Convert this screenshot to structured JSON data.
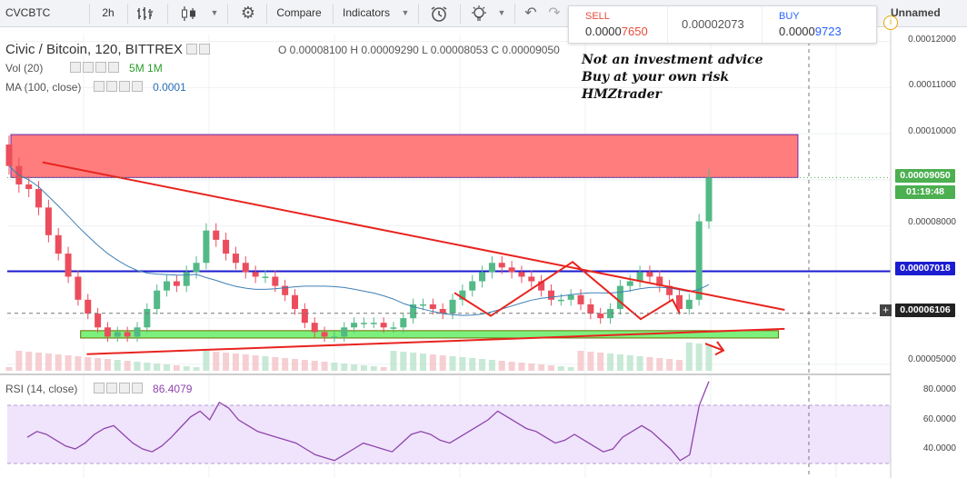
{
  "toolbar": {
    "symbol": "CVCBTC",
    "interval": "2h",
    "compare_label": "Compare",
    "indicators_label": "Indicators",
    "layout_name": "Unnamed"
  },
  "quote": {
    "sell_label": "SELL",
    "sell_price_main": "0.0000",
    "sell_price_tail": "7650",
    "spread": "0.00002073",
    "buy_label": "BUY",
    "buy_price_main": "0.0000",
    "buy_price_tail": "9723"
  },
  "legend": {
    "title": "Civic / Bitcoin, 120, BITTREX",
    "ohlc": "O 0.00008100  H 0.00009290  L 0.00008053  C 0.00009050",
    "vol_label": "Vol (20)",
    "vol_intervals": "5M  1M",
    "ma_label": "MA (100, close)",
    "ma_value": "0.0001",
    "rsi_label": "RSI (14, close)",
    "rsi_value": "86.4079"
  },
  "annotation": {
    "line1": "Not an investment advice",
    "line2": "Buy at your own risk",
    "line3": "HMZtrader"
  },
  "price_axis": {
    "ticks": [
      "0.00012000",
      "0.00011000",
      "0.00010000",
      "0.00008000",
      "0.00005000"
    ],
    "current_price": "0.00009050",
    "countdown": "01:19:48",
    "support_price": "0.00007018",
    "crosshair_price": "0.00006106"
  },
  "rsi_axis": {
    "ticks": [
      "80.0000",
      "60.0000",
      "40.0000"
    ]
  },
  "colors": {
    "up": "#53b987",
    "down": "#eb4d5c",
    "resistance_zone": "#ff7d7d",
    "support_zone": "#7cf07c",
    "trend_lines": "#e8241f",
    "support_line": "#1c1cd1",
    "ma_line": "#3e7fb5",
    "rsi_line": "#8e44ad",
    "rsi_band": "#efe4fb"
  },
  "chart_data": {
    "type": "candlestick",
    "ylim": [
      4.86e-05,
      0.0001215
    ],
    "grid": true,
    "horizontal_levels": {
      "resistance_zone": [
        9.05e-05,
        9.98e-05
      ],
      "support_zone": [
        5.57e-05,
        5.73e-05
      ],
      "support_line": 7.018e-05
    },
    "trend_lines": [
      {
        "name": "",
        "from": [
          0.04,
          9.38e-05
        ],
        "to": [
          0.88,
          6.18e-05
        ]
      },
      {
        "name": "",
        "from": [
          0.09,
          5.22e-05
        ],
        "to": [
          0.88,
          5.77e-05
        ]
      }
    ],
    "closes": [
      9.3e-05,
      8.9e-05,
      8.8e-05,
      8.4e-05,
      7.8e-05,
      7.4e-05,
      6.9e-05,
      6.4e-05,
      6.1e-05,
      5.8e-05,
      5.6e-05,
      5.7e-05,
      5.6e-05,
      5.8e-05,
      6.2e-05,
      6.6e-05,
      6.8e-05,
      6.7e-05,
      7e-05,
      7.2e-05,
      7.9e-05,
      7.7e-05,
      7.4e-05,
      7.2e-05,
      7e-05,
      6.9e-05,
      6.9e-05,
      6.7e-05,
      6.5e-05,
      6.2e-05,
      5.9e-05,
      5.7e-05,
      5.6e-05,
      5.6e-05,
      5.8e-05,
      5.9e-05,
      5.9e-05,
      5.9e-05,
      5.8e-05,
      5.8e-05,
      6e-05,
      6.3e-05,
      6.3e-05,
      6.2e-05,
      6.1e-05,
      6.4e-05,
      6.6e-05,
      6.8e-05,
      7e-05,
      7.2e-05,
      7.1e-05,
      7e-05,
      6.9e-05,
      6.8e-05,
      6.6e-05,
      6.4e-05,
      6.4e-05,
      6.5e-05,
      6.3e-05,
      6.1e-05,
      6e-05,
      6.2e-05,
      6.7e-05,
      6.8e-05,
      7e-05,
      6.9e-05,
      6.7e-05,
      6.5e-05,
      6.2e-05,
      6.4e-05,
      8.1e-05,
      9.05e-05
    ],
    "rsi": {
      "ylim": [
        20,
        90
      ],
      "band": [
        30,
        70
      ],
      "values": [
        48,
        52,
        50,
        46,
        42,
        40,
        44,
        50,
        54,
        56,
        50,
        44,
        40,
        38,
        42,
        48,
        55,
        62,
        66,
        60,
        72,
        68,
        60,
        56,
        52,
        50,
        48,
        46,
        44,
        40,
        36,
        34,
        32,
        36,
        40,
        44,
        42,
        40,
        38,
        44,
        50,
        52,
        50,
        46,
        44,
        48,
        52,
        56,
        60,
        66,
        62,
        58,
        54,
        52,
        48,
        44,
        46,
        50,
        46,
        42,
        38,
        40,
        48,
        52,
        56,
        52,
        46,
        40,
        32,
        36,
        70,
        86.4
      ]
    }
  }
}
